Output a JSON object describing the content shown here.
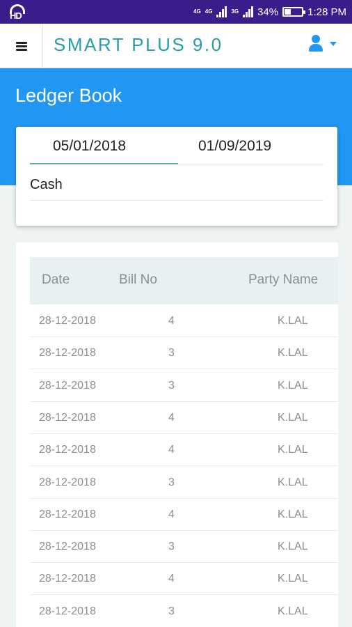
{
  "status_bar": {
    "hd": "HD",
    "net_top": "4G",
    "net_1": "4G",
    "net_2": "3G",
    "battery": "34%",
    "battery_level": 0.34,
    "time": "1:28 PM"
  },
  "app_bar": {
    "title": "SMART PLUS 9.0",
    "menu_icon": "hamburger-menu-icon",
    "user_icon": "user-icon",
    "accent_color": "#2a9da9"
  },
  "page": {
    "title": "Ledger Book",
    "header_color": "#2196f3"
  },
  "filter": {
    "from_date": "05/01/2018",
    "to_date": "01/09/2019",
    "account": "Cash"
  },
  "table": {
    "columns": [
      "Date",
      "Bill No",
      "Party Name"
    ],
    "rows": [
      {
        "date": "28-12-2018",
        "bill_no": "4",
        "party": "K.LAL"
      },
      {
        "date": "28-12-2018",
        "bill_no": "3",
        "party": "K.LAL"
      },
      {
        "date": "28-12-2018",
        "bill_no": "3",
        "party": "K.LAL"
      },
      {
        "date": "28-12-2018",
        "bill_no": "4",
        "party": "K.LAL"
      },
      {
        "date": "28-12-2018",
        "bill_no": "4",
        "party": "K.LAL"
      },
      {
        "date": "28-12-2018",
        "bill_no": "3",
        "party": "K.LAL"
      },
      {
        "date": "28-12-2018",
        "bill_no": "4",
        "party": "K.LAL"
      },
      {
        "date": "28-12-2018",
        "bill_no": "3",
        "party": "K.LAL"
      },
      {
        "date": "28-12-2018",
        "bill_no": "4",
        "party": "K.LAL"
      },
      {
        "date": "28-12-2018",
        "bill_no": "3",
        "party": "K.LAL"
      }
    ]
  }
}
